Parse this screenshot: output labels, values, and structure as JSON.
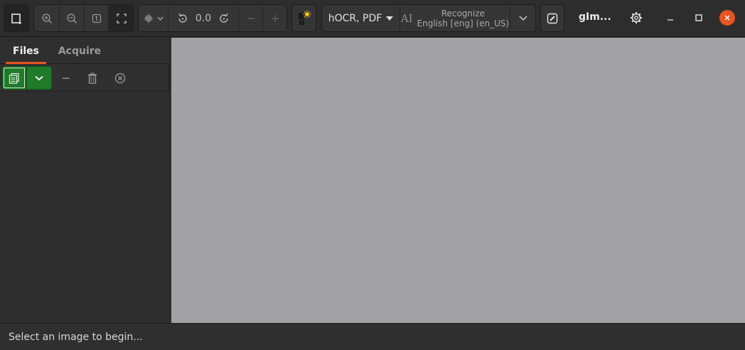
{
  "header": {
    "app_title": "gIm...",
    "zoom": {
      "zoom_in_icon": "zoom-in-icon",
      "zoom_out_icon": "zoom-out-icon",
      "zoom_one_icon": "zoom-original-icon",
      "zoom_fit_icon": "zoom-fit-icon"
    },
    "rotate_value": "0.0",
    "ocr": {
      "format_label": "hOCR, PDF",
      "recognize_title": "Recognize",
      "recognize_language": "English [eng] (en_US)"
    }
  },
  "sidebar": {
    "tabs": [
      {
        "label": "Files",
        "active": true
      },
      {
        "label": "Acquire",
        "active": false
      }
    ]
  },
  "status": {
    "message": "Select an image to begin..."
  },
  "colors": {
    "accent": "#e95420",
    "add_button_green": "#1f7a2a",
    "canvas_bg": "#a2a1a6"
  }
}
